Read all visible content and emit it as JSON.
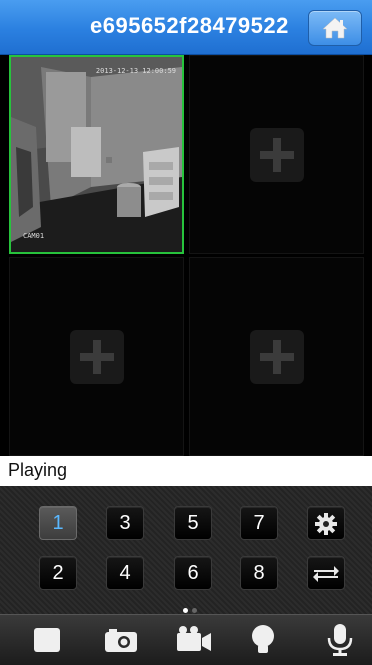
{
  "header": {
    "title": "e695652f28479522",
    "home_icon": "home-icon"
  },
  "video": {
    "channel1": {
      "timestamp": "2013-12-13 12:00:59",
      "label": "CAM01",
      "selected_border": "#27c33c"
    },
    "empty_slot_icon": "plus-icon"
  },
  "status": {
    "text": "Playing"
  },
  "channels": {
    "row1": [
      "1",
      "3",
      "5",
      "7"
    ],
    "row2": [
      "2",
      "4",
      "6",
      "8"
    ],
    "active": "1",
    "settings_icon": "gear-icon",
    "switch_icon": "switch-arrows-icon",
    "page_count": 2,
    "current_page": 1
  },
  "toolbar": {
    "items": [
      "stop-icon",
      "snapshot-camera-icon",
      "record-video-icon",
      "light-bulb-icon",
      "microphone-icon"
    ]
  },
  "colors": {
    "header_blue": "#2b80e0",
    "active_channel_text": "#5ab8ff"
  }
}
